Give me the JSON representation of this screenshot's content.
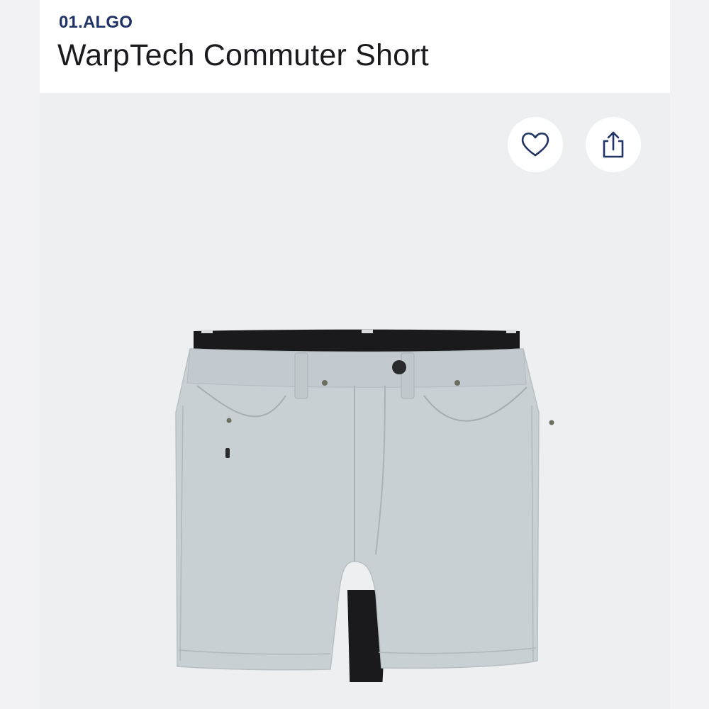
{
  "product": {
    "brand": "01.ALGO",
    "title": "WarpTech Commuter Short"
  },
  "actions": {
    "wishlist_icon": "heart-icon",
    "share_icon": "share-icon"
  },
  "image": {
    "subject": "light grey five-pocket shorts",
    "colors": {
      "fabric": "#c9d0d4",
      "waistband_lining": "#1a1a1c",
      "accent": "#1f3366"
    }
  }
}
